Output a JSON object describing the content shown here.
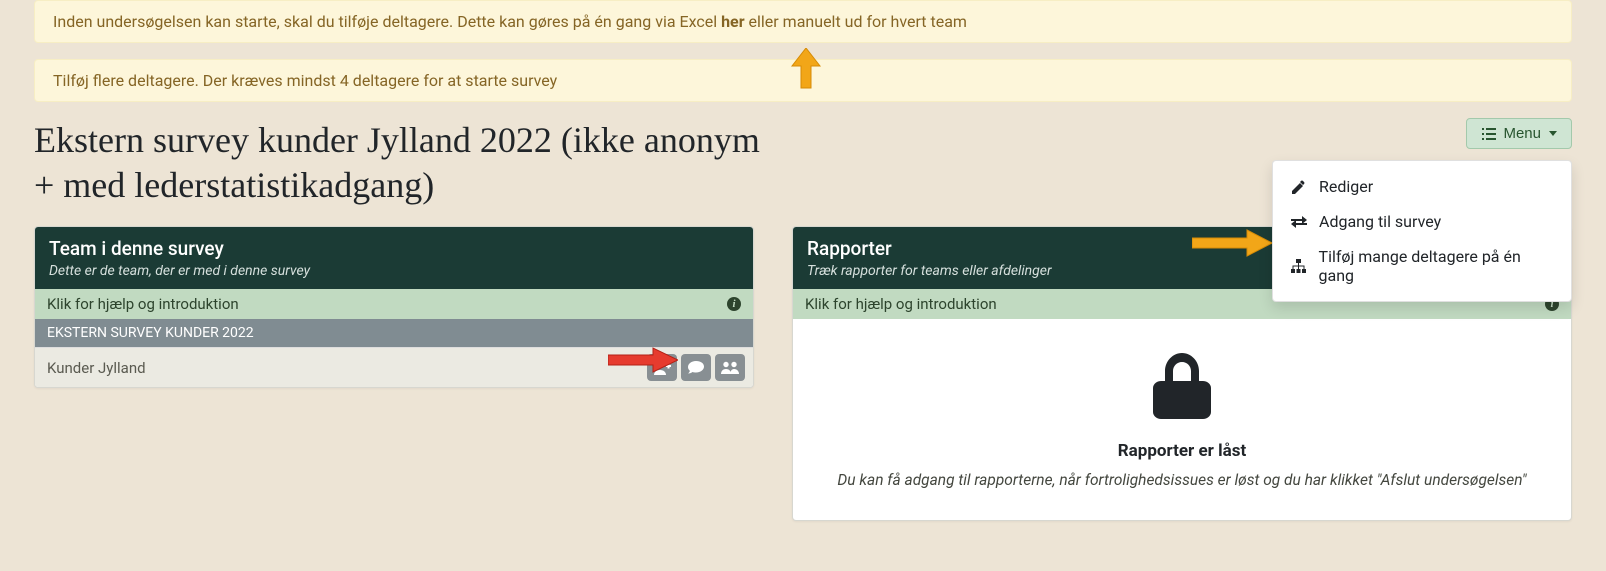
{
  "alerts": {
    "a1_pre": "Inden undersøgelsen kan starte, skal du tilføje deltagere. Dette kan gøres på én gang via Excel ",
    "a1_link": "her",
    "a1_post": " eller manuelt ud for hvert team",
    "a2": "Tilføj flere deltagere. Der kræves mindst 4 deltagere for at starte survey"
  },
  "page": {
    "title": "Ekstern survey kunder Jylland 2022 (ikke anonym + med lederstatistikadgang)"
  },
  "menu": {
    "button": "Menu",
    "items": {
      "edit": "Rediger",
      "access": "Adgang til survey",
      "add_many": "Tilføj mange deltagere på én gang"
    }
  },
  "panels": {
    "teams": {
      "title": "Team i denne survey",
      "subtitle": "Dette er de team, der er med i denne survey",
      "help": "Klik for hjælp og introduktion",
      "group": "EKSTERN SURVEY KUNDER 2022",
      "team1": "Kunder Jylland"
    },
    "reports": {
      "title": "Rapporter",
      "subtitle": "Træk rapporter for teams eller afdelinger",
      "help": "Klik for hjælp og introduktion",
      "locked_title": "Rapporter er låst",
      "locked_desc": "Du kan få adgang til rapporterne, når fortrolighedsissues er løst og du har klikket \"Afslut undersøgelsen\""
    }
  }
}
